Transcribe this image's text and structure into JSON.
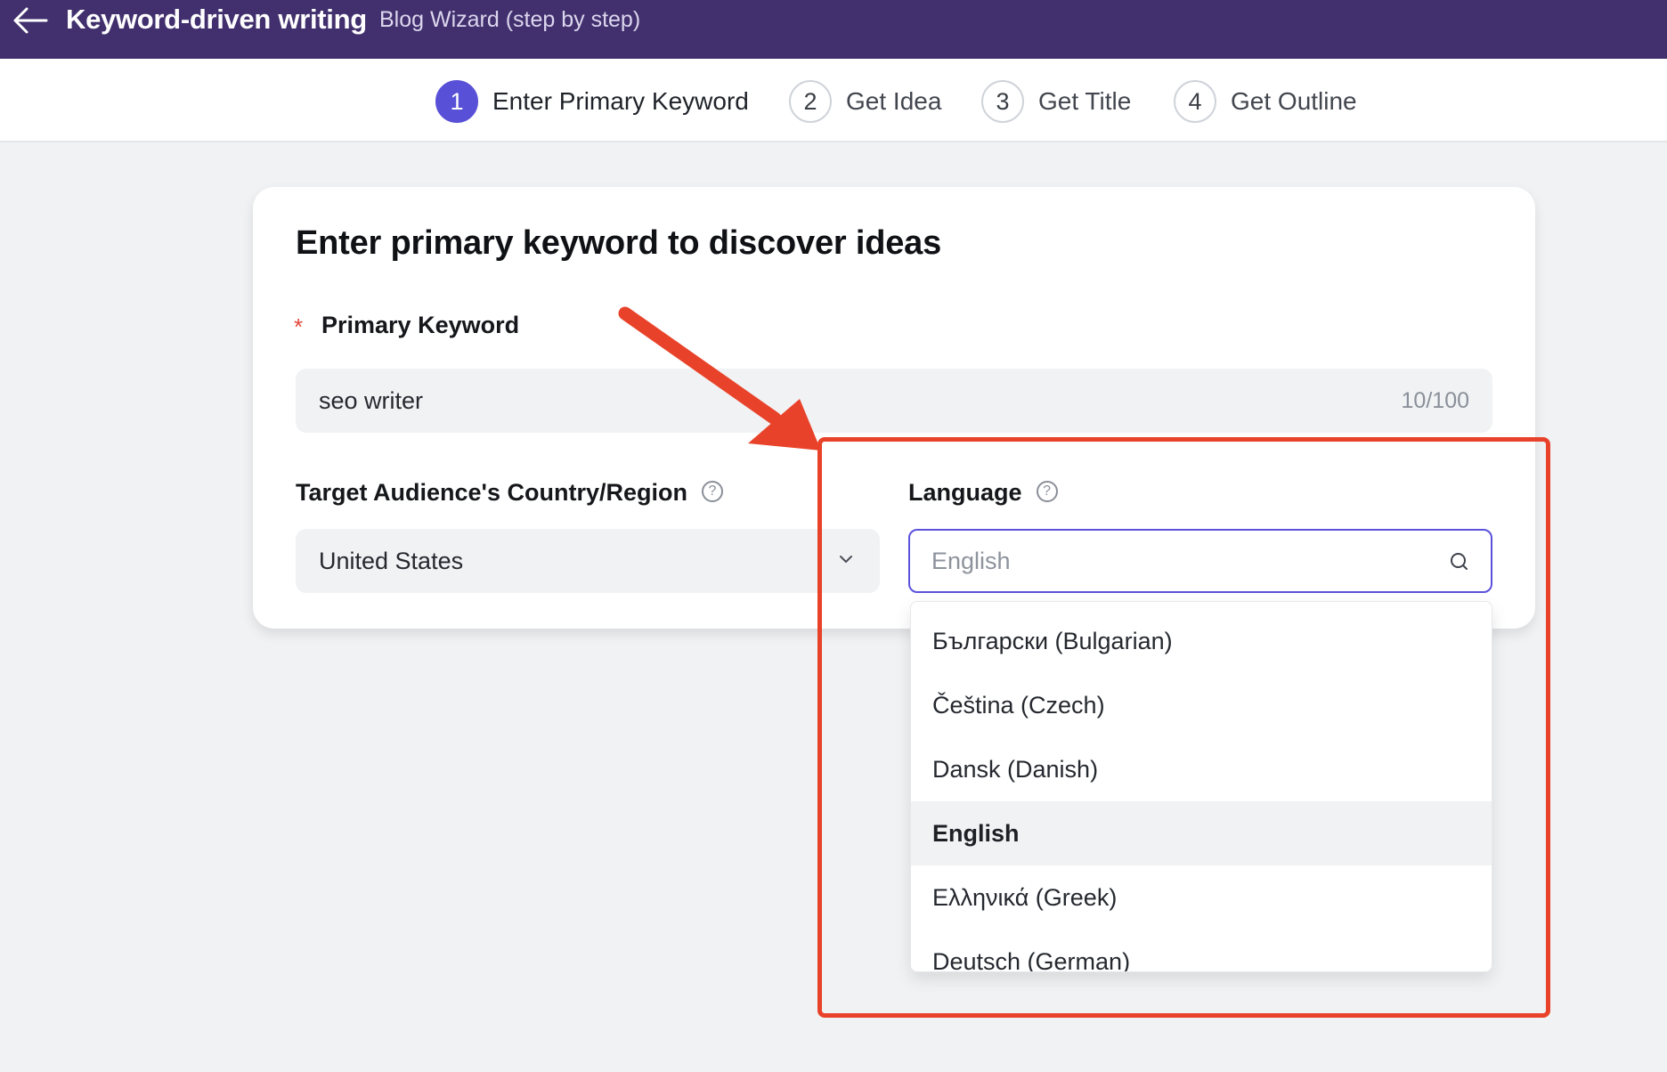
{
  "header": {
    "back_icon": "arrow-left-icon",
    "title": "Keyword-driven writing",
    "subtitle": "Blog Wizard (step by step)",
    "colors": {
      "background": "#41306d"
    }
  },
  "stepper": {
    "steps": [
      {
        "number": "1",
        "label": "Enter Primary Keyword",
        "active": true
      },
      {
        "number": "2",
        "label": "Get Idea",
        "active": false
      },
      {
        "number": "3",
        "label": "Get Title",
        "active": false
      },
      {
        "number": "4",
        "label": "Get Outline",
        "active": false
      }
    ],
    "colors": {
      "active": "#5850d6"
    }
  },
  "form": {
    "title": "Enter primary keyword to discover ideas",
    "primary_keyword": {
      "required_mark": "*",
      "label": "Primary Keyword",
      "value": "seo writer",
      "counter": "10/100"
    },
    "country": {
      "label": "Target Audience's Country/Region",
      "help_icon": "question-circle-icon",
      "help_glyph": "?",
      "selected": "United States",
      "chevron_icon": "chevron-down-icon"
    },
    "language": {
      "label": "Language",
      "help_icon": "question-circle-icon",
      "help_glyph": "?",
      "placeholder": "English",
      "search_icon": "search-icon",
      "options": [
        {
          "label": "Български (Bulgarian)",
          "selected": false
        },
        {
          "label": "Čeština (Czech)",
          "selected": false
        },
        {
          "label": "Dansk (Danish)",
          "selected": false
        },
        {
          "label": "English",
          "selected": true
        },
        {
          "label": "Ελληνικά (Greek)",
          "selected": false
        },
        {
          "label": "Deutsch (German)",
          "selected": false
        }
      ],
      "colors": {
        "focus_border": "#5b52db"
      }
    }
  },
  "annotation": {
    "color": "#e8432a",
    "shapes": [
      "arrow",
      "highlight-box"
    ]
  }
}
